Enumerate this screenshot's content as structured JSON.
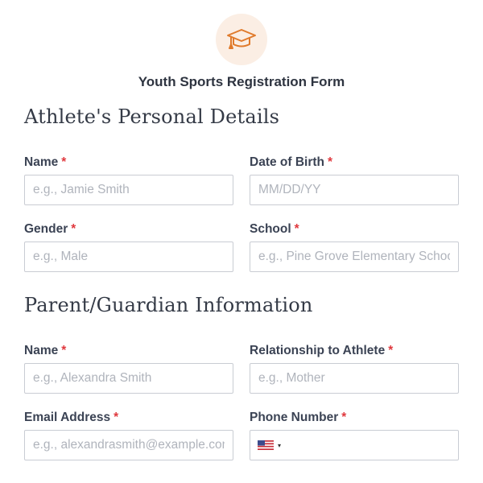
{
  "form": {
    "title": "Youth Sports Registration Form",
    "logo_icon": "graduation-cap-icon",
    "accent_color": "#e07a2b",
    "required_color": "#e0393e"
  },
  "sections": {
    "athlete": {
      "heading": "Athlete's Personal Details",
      "name": {
        "label": "Name",
        "required": "*",
        "placeholder": "e.g., Jamie Smith"
      },
      "dob": {
        "label": "Date of Birth",
        "required": "*",
        "placeholder": "MM/DD/YY"
      },
      "gender": {
        "label": "Gender",
        "required": "*",
        "placeholder": "e.g., Male"
      },
      "school": {
        "label": "School",
        "required": "*",
        "placeholder": "e.g., Pine Grove Elementary School"
      }
    },
    "parent": {
      "heading": "Parent/Guardian Information",
      "name": {
        "label": "Name",
        "required": "*",
        "placeholder": "e.g., Alexandra Smith"
      },
      "relationship": {
        "label": "Relationship to Athlete",
        "required": "*",
        "placeholder": "e.g., Mother"
      },
      "email": {
        "label": "Email Address",
        "required": "*",
        "placeholder": "e.g., alexandrasmith@example.com"
      },
      "phone": {
        "label": "Phone Number",
        "required": "*",
        "country_icon": "us-flag-icon",
        "caret_icon": "caret-down-icon",
        "caret": "▾"
      }
    }
  }
}
